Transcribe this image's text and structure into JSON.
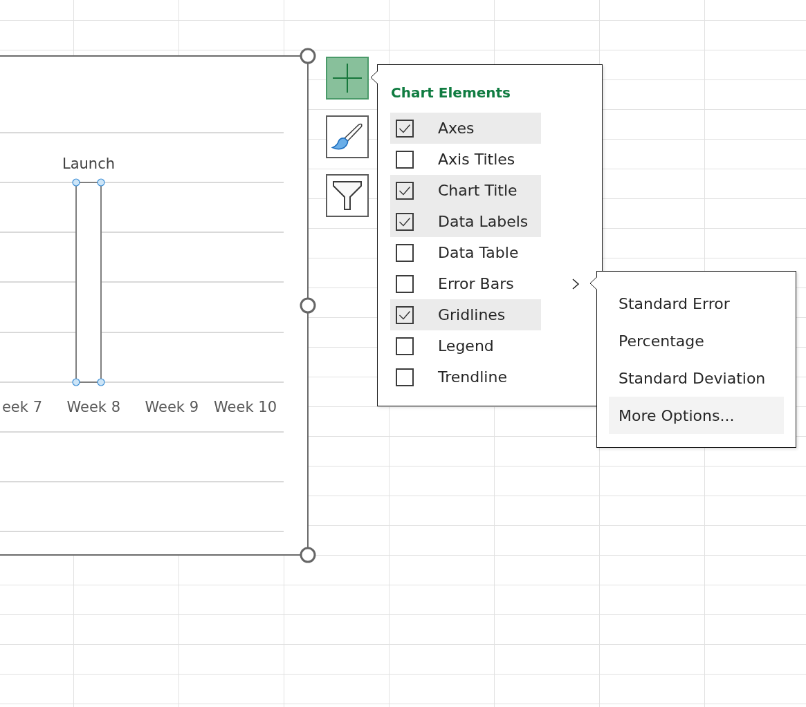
{
  "chart": {
    "selected": true,
    "categories": [
      {
        "label": "eek 7"
      },
      {
        "label": "Week 8",
        "bar": {
          "data_label": "Launch",
          "selected": true
        }
      },
      {
        "label": "Week 9"
      },
      {
        "label": "Week 10"
      }
    ]
  },
  "chart_buttons": [
    {
      "kind": "elements",
      "selected": true
    },
    {
      "kind": "styles",
      "selected": false
    },
    {
      "kind": "filters",
      "selected": false
    }
  ],
  "chart_elements": {
    "title": "Chart Elements",
    "items": [
      {
        "label": "Axes",
        "checked": true,
        "expanded": false
      },
      {
        "label": "Axis Titles",
        "checked": false,
        "expanded": false
      },
      {
        "label": "Chart Title",
        "checked": true,
        "expanded": false
      },
      {
        "label": "Data Labels",
        "checked": true,
        "expanded": false
      },
      {
        "label": "Data Table",
        "checked": false,
        "expanded": false
      },
      {
        "label": "Error Bars",
        "checked": false,
        "expanded": true,
        "submenu": {
          "items": [
            {
              "label": "Standard Error",
              "highlighted": false
            },
            {
              "label": "Percentage",
              "highlighted": false
            },
            {
              "label": "Standard Deviation",
              "highlighted": false
            },
            {
              "label": "More Options...",
              "highlighted": true
            }
          ]
        }
      },
      {
        "label": "Gridlines",
        "checked": true,
        "expanded": false
      },
      {
        "label": "Legend",
        "checked": false,
        "expanded": false
      },
      {
        "label": "Trendline",
        "checked": false,
        "expanded": false
      }
    ]
  }
}
